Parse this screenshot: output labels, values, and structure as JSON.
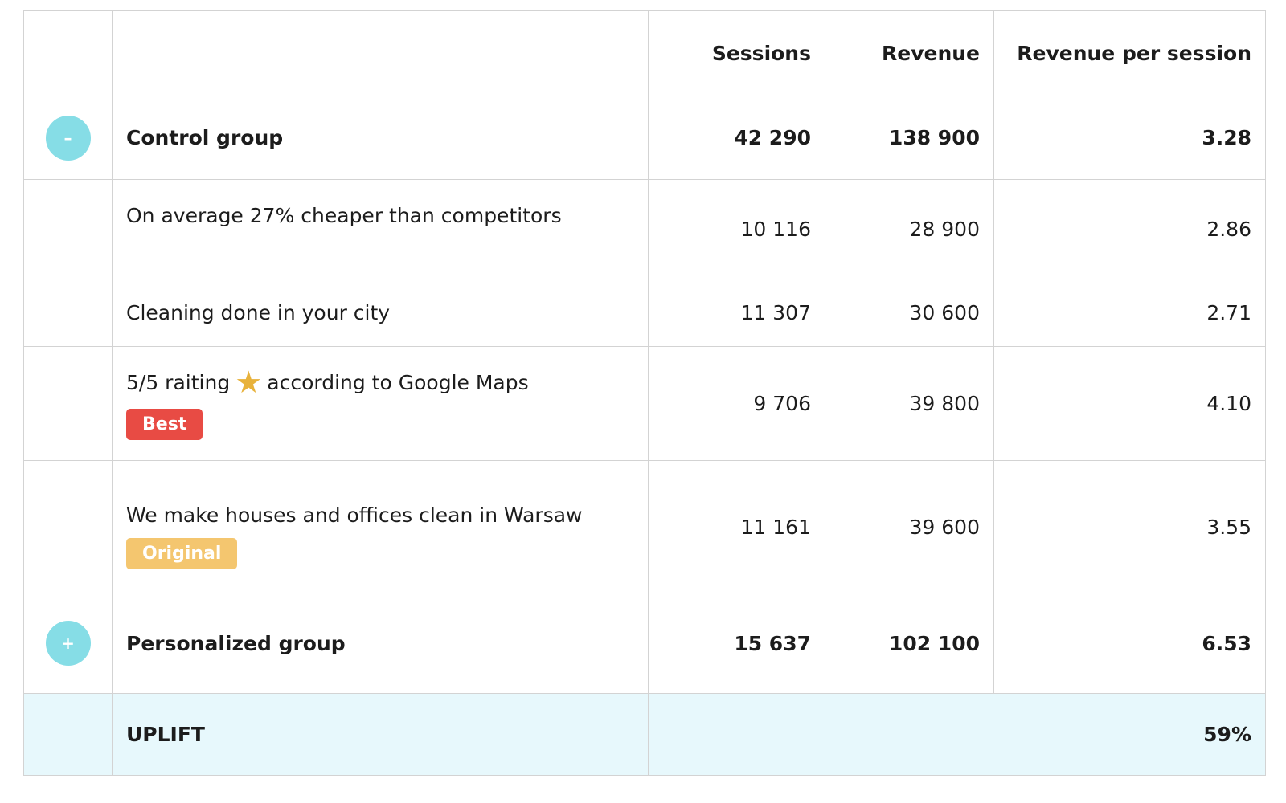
{
  "table": {
    "headers": {
      "sessions": "Sessions",
      "revenue": "Revenue",
      "revenue_per_session": "Revenue per session"
    },
    "control_group": {
      "toggle_symbol": "–",
      "label": "Control group",
      "sessions": "42 290",
      "revenue": "138 900",
      "rps": "3.28"
    },
    "variants": [
      {
        "label": "On average 27% cheaper than competitors",
        "sessions": "10 116",
        "revenue": "28 900",
        "rps": "2.86"
      },
      {
        "label": "Cleaning done in your city",
        "sessions": "11 307",
        "revenue": "30 600",
        "rps": "2.71"
      },
      {
        "label_before": "5/5 raiting",
        "star": "★",
        "label_after": "according to Google Maps",
        "badge": "Best",
        "sessions": "9 706",
        "revenue": "39 800",
        "rps": "4.10"
      },
      {
        "label": "We make houses and offices clean in Warsaw",
        "badge": "Original",
        "sessions": "11 161",
        "revenue": "39 600",
        "rps": "3.55"
      }
    ],
    "personalized_group": {
      "toggle_symbol": "+",
      "label": "Personalized group",
      "sessions": "15 637",
      "revenue": "102 100",
      "rps": "6.53"
    },
    "uplift": {
      "label": "UPLIFT",
      "value": "59%"
    }
  },
  "colors": {
    "toggle": "#86dde6",
    "best_badge": "#e84b44",
    "original_badge": "#f4c66f",
    "star": "#e8b23b",
    "uplift_bg": "#e7f8fc",
    "border": "#d3d3d3"
  },
  "icons": {
    "collapse": "minus-icon",
    "expand": "plus-icon",
    "rating": "star-icon"
  }
}
